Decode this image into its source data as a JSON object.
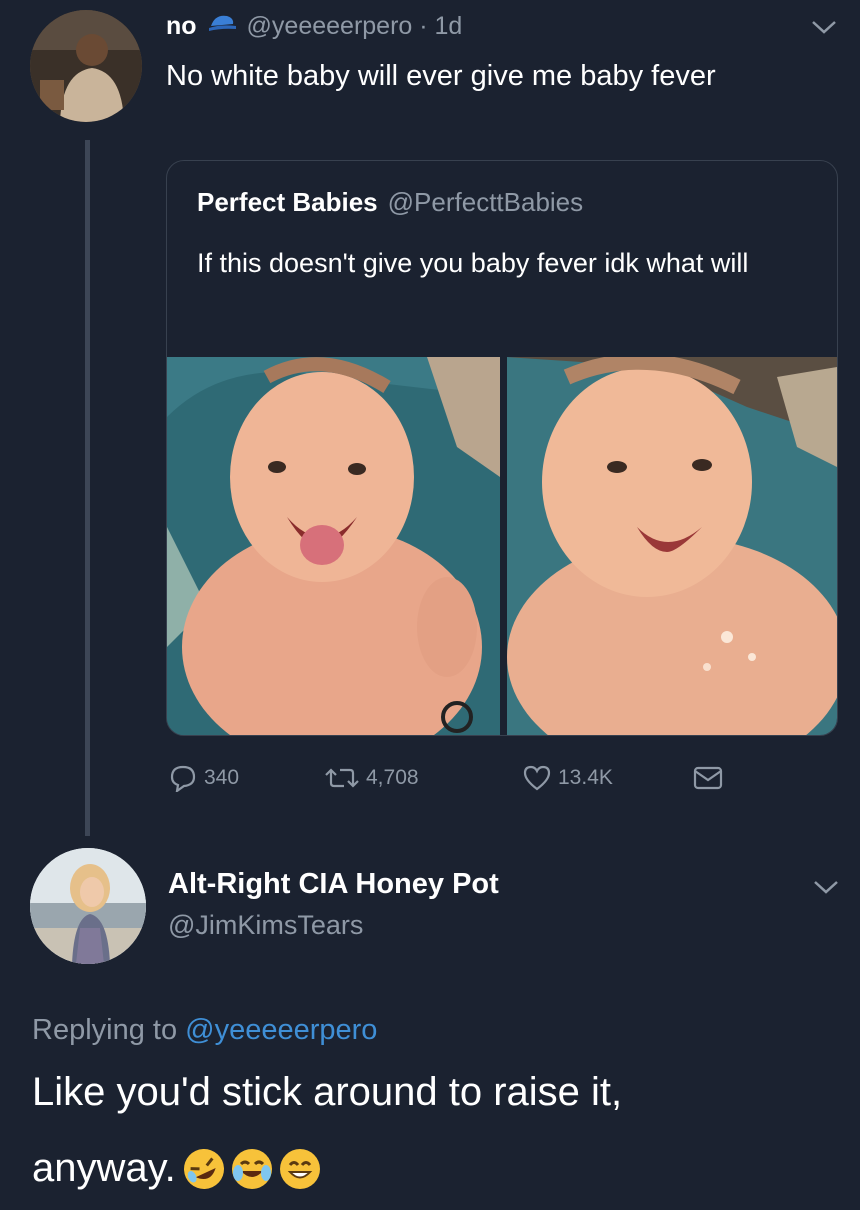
{
  "tweet1": {
    "display_name": "no",
    "handle_time": "@yeeeeerpero · 1d",
    "text": "No white baby will ever give me baby fever",
    "verified_icon": "hat-icon"
  },
  "quoted": {
    "display_name": "Perfect Babies",
    "handle": "@PerfecttBabies",
    "text": "If this doesn't give you baby fever idk what will"
  },
  "actions": {
    "replies": "340",
    "retweets": "4,708",
    "likes": "13.4K"
  },
  "reply": {
    "display_name": "Alt-Right CIA Honey Pot",
    "handle": "@JimKimsTears",
    "replying_prefix": "Replying to",
    "replying_to": "@yeeeeerpero",
    "text_line1": "Like you'd stick around to raise it,",
    "text_line2": "anyway.",
    "emojis": [
      "rolling-on-floor-laughing",
      "tears-of-joy",
      "grinning-face-smiling-eyes"
    ]
  },
  "colors": {
    "background": "#1b2230",
    "muted": "#8f99a6",
    "link": "#3f8fd6"
  }
}
